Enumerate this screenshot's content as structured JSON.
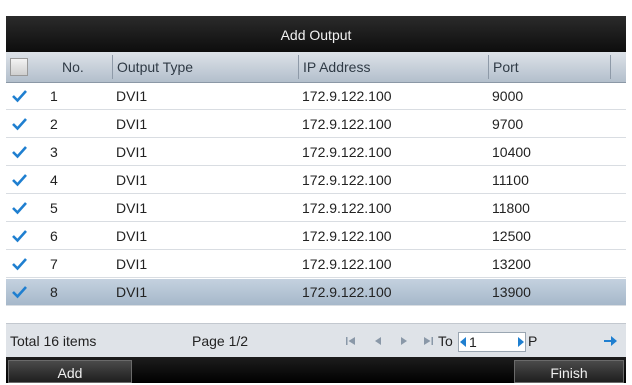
{
  "dialog": {
    "title": "Add Output"
  },
  "table": {
    "columns": [
      "No.",
      "Output Type",
      "IP Address",
      "Port"
    ],
    "rows": [
      {
        "no": "1",
        "type": "DVI1",
        "ip": "172.9.122.100",
        "port": "9000",
        "checked": true
      },
      {
        "no": "2",
        "type": "DVI1",
        "ip": "172.9.122.100",
        "port": "9700",
        "checked": true
      },
      {
        "no": "3",
        "type": "DVI1",
        "ip": "172.9.122.100",
        "port": "10400",
        "checked": true
      },
      {
        "no": "4",
        "type": "DVI1",
        "ip": "172.9.122.100",
        "port": "11100",
        "checked": true
      },
      {
        "no": "5",
        "type": "DVI1",
        "ip": "172.9.122.100",
        "port": "11800",
        "checked": true
      },
      {
        "no": "6",
        "type": "DVI1",
        "ip": "172.9.122.100",
        "port": "12500",
        "checked": true
      },
      {
        "no": "7",
        "type": "DVI1",
        "ip": "172.9.122.100",
        "port": "13200",
        "checked": true
      },
      {
        "no": "8",
        "type": "DVI1",
        "ip": "172.9.122.100",
        "port": "13900",
        "checked": true,
        "selected": true
      }
    ]
  },
  "footer": {
    "total": "Total 16 items",
    "page": "Page 1/2",
    "to_label": "To",
    "page_input": "1",
    "p_label": "P"
  },
  "buttons": {
    "add": "Add",
    "finish": "Finish"
  },
  "icons": [
    "first-page-icon",
    "prev-page-icon",
    "next-page-icon",
    "last-page-icon",
    "go-arrow-icon",
    "checkmark-icon"
  ],
  "colors": {
    "accent": "#1f7fd0",
    "selected_row": "#b4c3d3",
    "title_bar": "#1a1a1a"
  }
}
